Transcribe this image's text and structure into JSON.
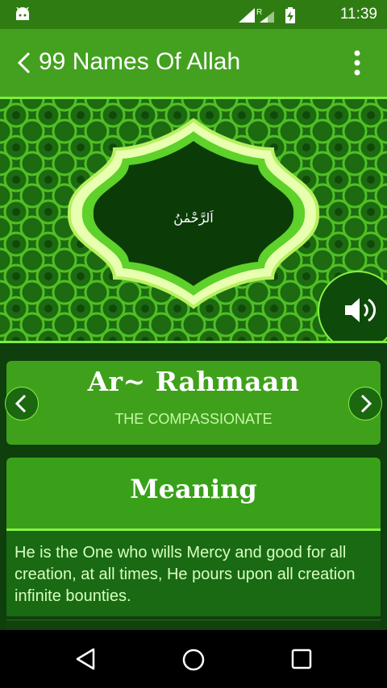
{
  "status_bar": {
    "time": "11:39",
    "icons": [
      "android-icon",
      "signal-icon",
      "roaming-icon",
      "battery-charging-icon"
    ]
  },
  "app_bar": {
    "title": "99 Names Of Allah",
    "back_icon": "chevron-left-icon",
    "menu_icon": "more-vert-icon"
  },
  "hero": {
    "arabic_name": "اَلرَّحْمٰنُ",
    "speaker_icon": "volume-icon"
  },
  "name_card": {
    "name": "Ar~ Rahmaan",
    "translation": "THE COMPASSIONATE",
    "prev_icon": "chevron-left-icon",
    "next_icon": "chevron-right-icon"
  },
  "meaning": {
    "heading": "Meaning",
    "text": "He is the One who wills Mercy and good for all creation, at all times, He pours upon all creation infinite bounties."
  },
  "nav_bar": {
    "icons": [
      "back-triangle-icon",
      "home-circle-icon",
      "recents-square-icon"
    ]
  },
  "colors": {
    "app_bar": "#43a11f",
    "accent": "#86f142",
    "dark_bg": "#0e3f0c"
  }
}
